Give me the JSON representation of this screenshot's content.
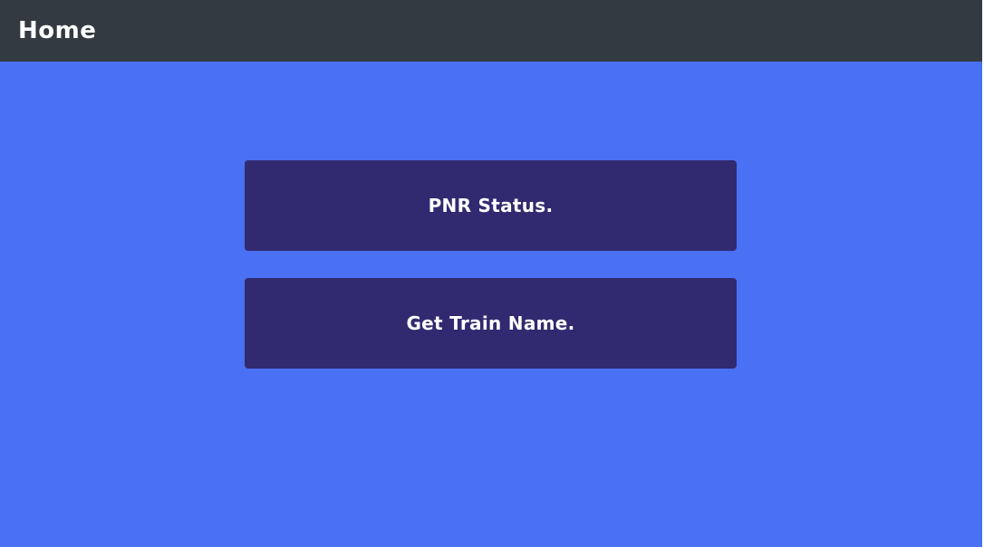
{
  "app_bar": {
    "title": "Home"
  },
  "menu": {
    "pnr_status_label": "PNR Status.",
    "get_train_name_label": "Get Train Name."
  },
  "colors": {
    "app_bar_background": "#343a42",
    "page_background": "#4a70f4",
    "button_background": "#312a70",
    "text": "#ffffff"
  }
}
